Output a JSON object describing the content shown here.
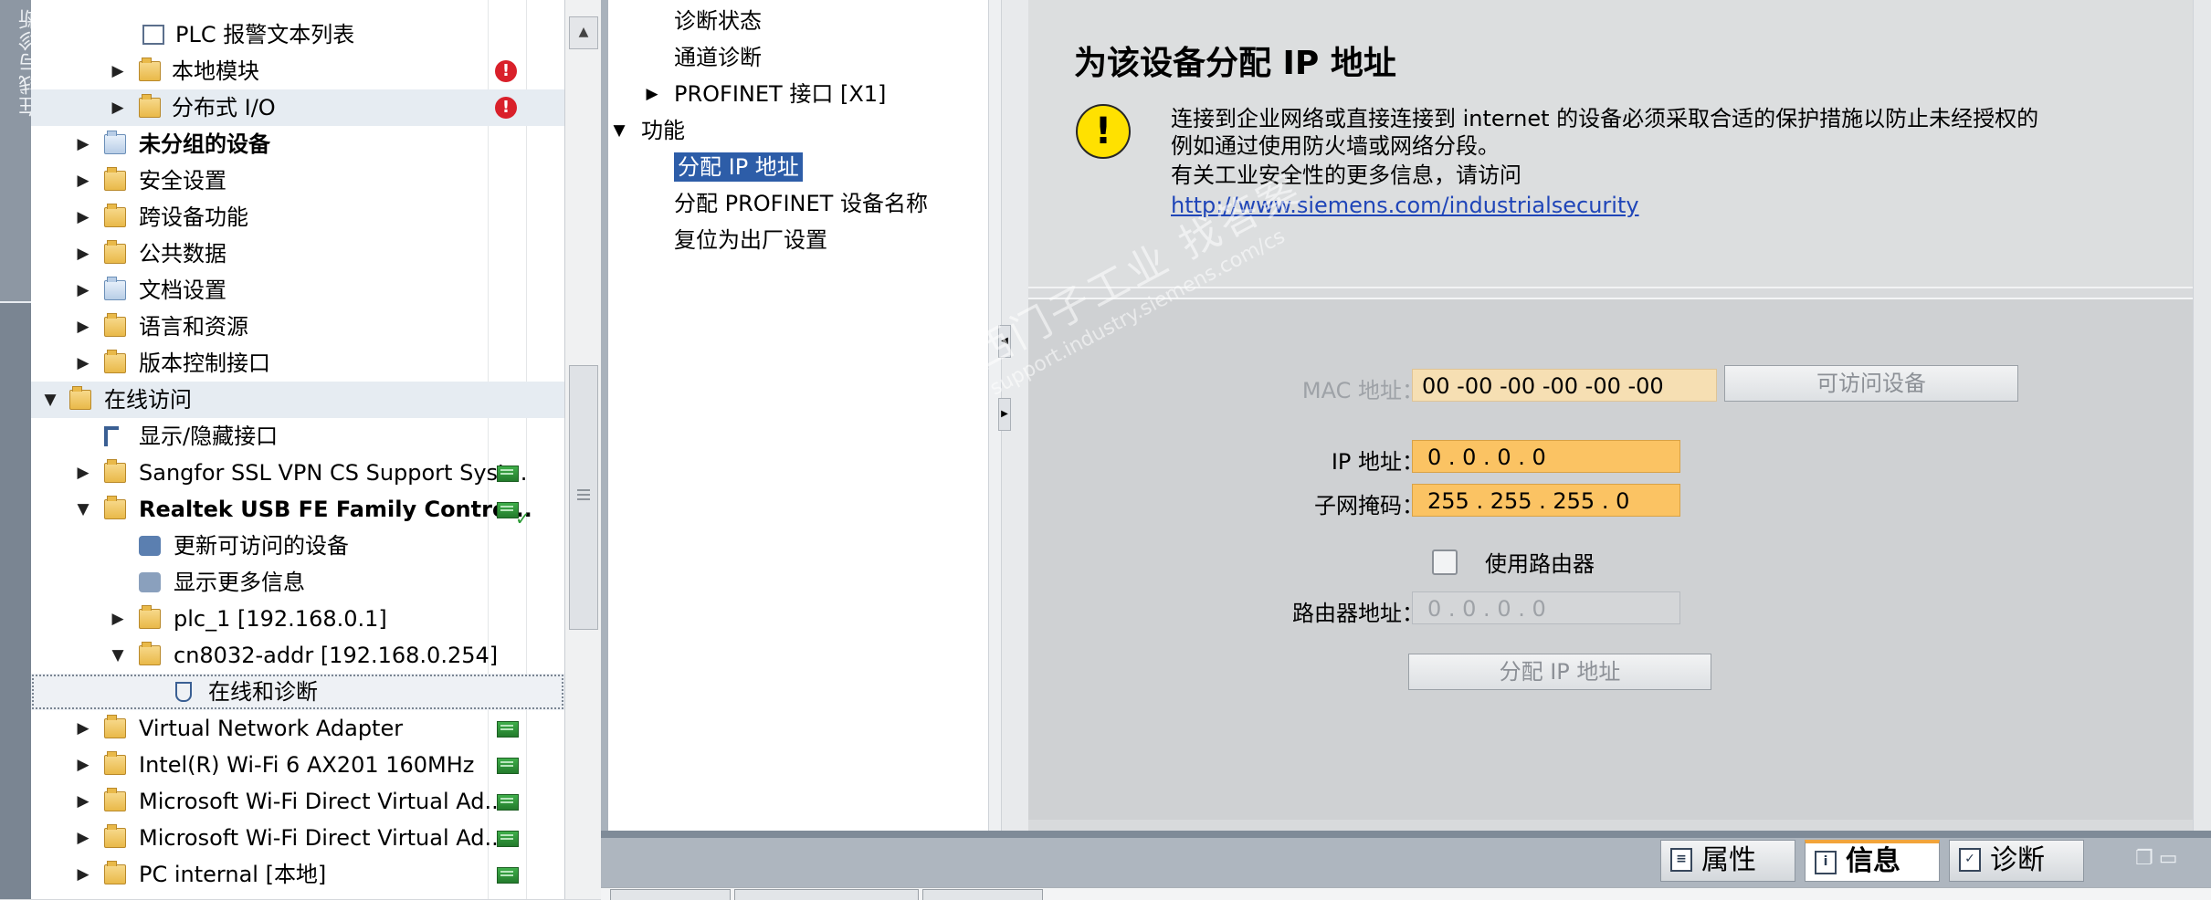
{
  "side_strip": {
    "label": "在线与诊断"
  },
  "project_tree": {
    "rows": [
      {
        "label": "PLC 报警文本列表",
        "expander": "",
        "icon": "document-icon",
        "status": ""
      },
      {
        "label": "本地模块",
        "expander": "▶",
        "icon": "folder-icon",
        "status": "error"
      },
      {
        "label": "分布式 I/O",
        "expander": "▶",
        "icon": "folder-icon",
        "status": "error"
      },
      {
        "label": "未分组的设备",
        "expander": "▶",
        "icon": "devices-icon",
        "status": ""
      },
      {
        "label": "安全设置",
        "expander": "▶",
        "icon": "security-icon",
        "status": ""
      },
      {
        "label": "跨设备功能",
        "expander": "▶",
        "icon": "cross-device-icon",
        "status": ""
      },
      {
        "label": "公共数据",
        "expander": "▶",
        "icon": "common-data-icon",
        "status": ""
      },
      {
        "label": "文档设置",
        "expander": "▶",
        "icon": "document-settings-icon",
        "status": ""
      },
      {
        "label": "语言和资源",
        "expander": "▶",
        "icon": "languages-icon",
        "status": ""
      },
      {
        "label": "版本控制接口",
        "expander": "▶",
        "icon": "version-control-icon",
        "status": ""
      },
      {
        "label": "在线访问",
        "expander": "▼",
        "icon": "online-access-icon",
        "status": ""
      },
      {
        "label": "显示/隐藏接口",
        "expander": "",
        "icon": "interface-icon",
        "status": ""
      },
      {
        "label": "Sangfor SSL VPN CS Support Syst...",
        "expander": "▶",
        "icon": "adapter-folder-icon",
        "status": "net"
      },
      {
        "label": "Realtek USB FE Family Contro...",
        "expander": "▼",
        "icon": "adapter-folder-icon",
        "status": "net-connected"
      },
      {
        "label": "更新可访问的设备",
        "expander": "",
        "icon": "update-devices-icon",
        "status": ""
      },
      {
        "label": "显示更多信息",
        "expander": "",
        "icon": "more-info-icon",
        "status": ""
      },
      {
        "label": "plc_1 [192.168.0.1]",
        "expander": "▶",
        "icon": "device-folder-icon",
        "status": ""
      },
      {
        "label": "cn8032-addr [192.168.0.254]",
        "expander": "▼",
        "icon": "device-folder-icon",
        "status": ""
      },
      {
        "label": "在线和诊断",
        "expander": "",
        "icon": "diagnostics-icon",
        "status": ""
      },
      {
        "label": "Virtual Network Adapter",
        "expander": "▶",
        "icon": "adapter-folder-icon",
        "status": "net"
      },
      {
        "label": "Intel(R) Wi-Fi 6 AX201 160MHz",
        "expander": "▶",
        "icon": "adapter-folder-icon",
        "status": "net"
      },
      {
        "label": "Microsoft Wi-Fi Direct Virtual Ad...",
        "expander": "▶",
        "icon": "adapter-folder-icon",
        "status": "net"
      },
      {
        "label": "Microsoft Wi-Fi Direct Virtual Ad...",
        "expander": "▶",
        "icon": "adapter-folder-icon",
        "status": "net"
      },
      {
        "label": "PC internal [本地]",
        "expander": "▶",
        "icon": "adapter-folder-icon",
        "status": "net"
      }
    ]
  },
  "nav": {
    "items": [
      {
        "label": "诊断状态"
      },
      {
        "label": "通道诊断"
      },
      {
        "label": "PROFINET 接口 [X1]"
      },
      {
        "label": "功能"
      },
      {
        "label": "分配 IP 地址"
      },
      {
        "label": "分配 PROFINET 设备名称"
      },
      {
        "label": "复位为出厂设置"
      }
    ]
  },
  "main": {
    "title": "为该设备分配 IP 地址",
    "warning_line1": "连接到企业网络或直接连接到 internet 的设备必须采取合适的保护措施以防止未经授权的",
    "warning_line2": "例如通过使用防火墙或网络分段。",
    "warning_line3": "有关工业安全性的更多信息，请访问",
    "warning_link": "http://www.siemens.com/industrialsecurity",
    "mac_label": "MAC 地址：",
    "mac_value": "00 -00 -00 -00 -00 -00",
    "accessible_devices_button": "可访问设备",
    "ip_label": "IP 地址：",
    "ip_value": "0    . 0     . 0     . 0",
    "subnet_label": "子网掩码：",
    "subnet_value": "255  . 255  . 255  . 0",
    "use_router_label": "使用路由器",
    "router_label": "路由器地址：",
    "router_value": "0    . 0     . 0     . 0",
    "assign_button": "分配 IP 地址"
  },
  "watermark": {
    "line1": "西门子工业 找答案",
    "line2": "support.industry.siemens.com/cs"
  },
  "bottom_tabs": [
    {
      "label": "属性",
      "icon": "properties-icon"
    },
    {
      "label": "信息",
      "icon": "info-icon"
    },
    {
      "label": "诊断",
      "icon": "diagnostics-tab-icon"
    }
  ],
  "colors": {
    "selection": "#2d5da8",
    "ip_field": "#fbc363",
    "mac_field": "#f6dfb3",
    "error": "#d9202a",
    "warning": "#ffe100",
    "active_tab_accent": "#f2a43a"
  }
}
